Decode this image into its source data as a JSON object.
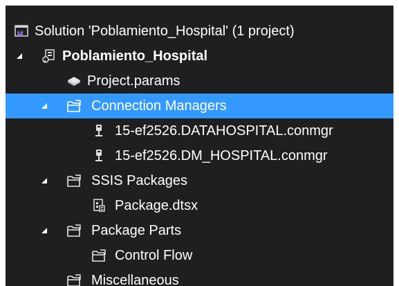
{
  "solution_explorer": {
    "colors": {
      "background": "#1f1f1f",
      "selection": "#3399ff",
      "text": "#ffffff",
      "folder_icon": "#e6e6e6",
      "solution_icon": "#6a5acd"
    },
    "items": [
      {
        "label": "Solution 'Poblamiento_Hospital' (1 project)",
        "icon": "solution-icon",
        "expanded": null,
        "bold": false,
        "selected": false
      },
      {
        "label": "Poblamiento_Hospital",
        "icon": "ssis-project-icon",
        "expanded": true,
        "bold": true,
        "selected": false
      },
      {
        "label": "Project.params",
        "icon": "params-icon",
        "expanded": null,
        "bold": false,
        "selected": false
      },
      {
        "label": "Connection Managers",
        "icon": "folder-icon",
        "expanded": true,
        "bold": false,
        "selected": true
      },
      {
        "label": "15-ef2526.DATAHOSPITAL.conmgr",
        "icon": "connection-manager-icon",
        "expanded": null,
        "bold": false,
        "selected": false
      },
      {
        "label": "15-ef2526.DM_HOSPITAL.conmgr",
        "icon": "connection-manager-icon",
        "expanded": null,
        "bold": false,
        "selected": false
      },
      {
        "label": "SSIS Packages",
        "icon": "folder-icon",
        "expanded": true,
        "bold": false,
        "selected": false
      },
      {
        "label": "Package.dtsx",
        "icon": "package-icon",
        "expanded": null,
        "bold": false,
        "selected": false
      },
      {
        "label": "Package Parts",
        "icon": "folder-icon",
        "expanded": true,
        "bold": false,
        "selected": false
      },
      {
        "label": "Control Flow",
        "icon": "folder-icon",
        "expanded": null,
        "bold": false,
        "selected": false
      },
      {
        "label": "Miscellaneous",
        "icon": "folder-icon",
        "expanded": null,
        "bold": false,
        "selected": false
      }
    ]
  }
}
